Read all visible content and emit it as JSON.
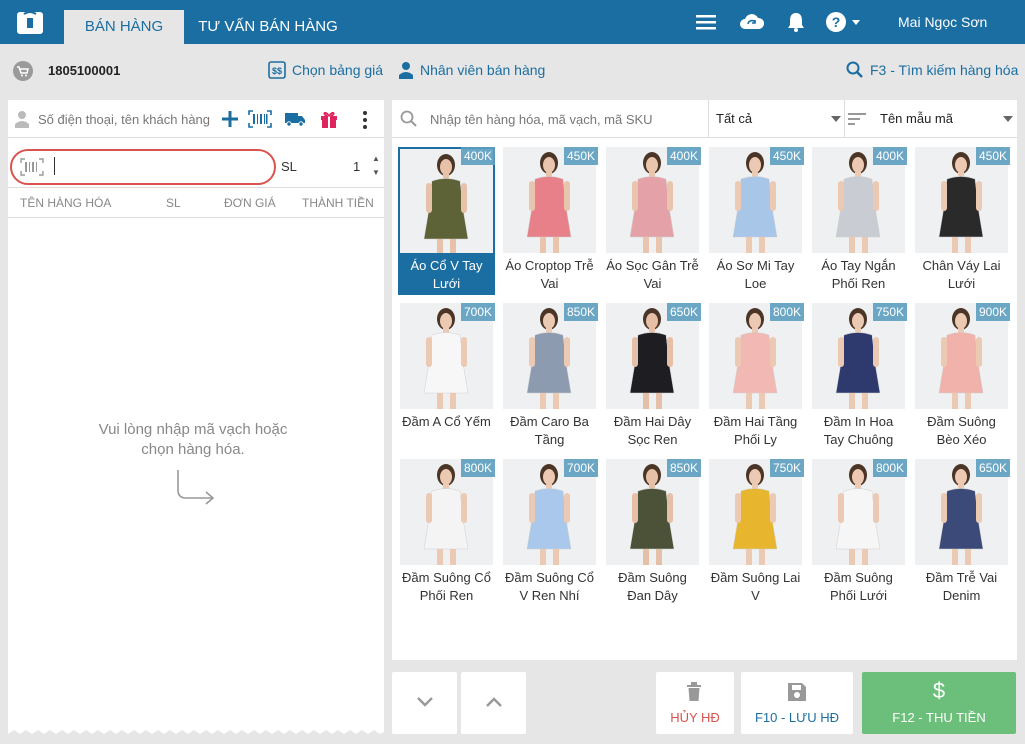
{
  "header": {
    "tabs": [
      "BÁN HÀNG",
      "TƯ VẤN BÁN HÀNG"
    ],
    "user": "Mai Ngọc Sơn",
    "icons": [
      "menu-icon",
      "cloud-sync-icon",
      "bell-icon",
      "help-icon"
    ]
  },
  "subbar": {
    "invoice_id": "1805100001",
    "price_list": "Chọn bảng giá",
    "sales_staff": "Nhân viên bán hàng",
    "search_hint": "F3 - Tìm kiếm hàng hóa"
  },
  "cart": {
    "customer_placeholder": "Số điện thoại, tên khách hàng",
    "qty_label": "SL",
    "qty_value": "1",
    "columns": [
      "TÊN HÀNG HÓA",
      "SL",
      "ĐƠN GIÁ",
      "THÀNH TIỀN"
    ],
    "empty_line1": "Vui lòng nhập mã vạch hoặc",
    "empty_line2": "chọn hàng hóa."
  },
  "catalog": {
    "search_placeholder": "Nhập tên hàng hóa, mã vạch, mã SKU",
    "filter_value": "Tất cả",
    "sort_value": "Tên mẫu mã",
    "products": [
      {
        "name1": "Áo Cổ V Tay",
        "name2": "Lưới",
        "price": "400K",
        "color": "#5e6237",
        "skin": "#e8c2a8",
        "selected": true
      },
      {
        "name1": "Áo Croptop Trễ",
        "name2": "Vai",
        "price": "450K",
        "color": "#e8808a",
        "skin": "#e9c5ae",
        "selected": false
      },
      {
        "name1": "Áo Sọc Gân Trễ",
        "name2": "Vai",
        "price": "400K",
        "color": "#e4a2a8",
        "skin": "#e9c5ae",
        "selected": false
      },
      {
        "name1": "Áo Sơ Mi Tay",
        "name2": "Loe",
        "price": "450K",
        "color": "#a8c6e8",
        "skin": "#ebc9b2",
        "selected": false
      },
      {
        "name1": "Áo Tay Ngắn",
        "name2": "Phối Ren",
        "price": "400K",
        "color": "#c9ccd2",
        "skin": "#ebc9b2",
        "selected": false
      },
      {
        "name1": "Chân Váy Lai",
        "name2": "Lưới",
        "price": "450K",
        "color": "#2a2a2a",
        "skin": "#ebc9b2",
        "selected": false
      },
      {
        "name1": "Đầm A Cổ Yếm",
        "name2": "",
        "price": "700K",
        "color": "#f7f7f7",
        "skin": "#ebc9b2",
        "selected": false
      },
      {
        "name1": "Đầm Caro Ba",
        "name2": "Tầng",
        "price": "850K",
        "color": "#8d9bb0",
        "skin": "#ebc9b2",
        "selected": false
      },
      {
        "name1": "Đầm Hai Dây",
        "name2": "Sọc Ren",
        "price": "650K",
        "color": "#1e1e22",
        "skin": "#e6c0a6",
        "selected": false
      },
      {
        "name1": "Đầm Hai Tầng",
        "name2": "Phối Ly",
        "price": "800K",
        "color": "#f2b9b4",
        "skin": "#ebc9b2",
        "selected": false
      },
      {
        "name1": "Đầm In Hoa",
        "name2": "Tay Chuông",
        "price": "750K",
        "color": "#2e3a6e",
        "skin": "#ebc9b2",
        "selected": false
      },
      {
        "name1": "Đầm Suông",
        "name2": "Bèo Xéo",
        "price": "900K",
        "color": "#f0b2aa",
        "skin": "#ebc9b2",
        "selected": false
      },
      {
        "name1": "Đầm Suông Cổ",
        "name2": "Phối Ren",
        "price": "800K",
        "color": "#f4f4f4",
        "skin": "#ebc9b2",
        "selected": false
      },
      {
        "name1": "Đầm Suông Cổ",
        "name2": "V Ren Nhí",
        "price": "700K",
        "color": "#a9c8ec",
        "skin": "#ebc9b2",
        "selected": false
      },
      {
        "name1": "Đầm Suông",
        "name2": "Đan Dây",
        "price": "850K",
        "color": "#4b5237",
        "skin": "#e6c0a6",
        "selected": false
      },
      {
        "name1": "Đầm Suông Lai",
        "name2": "V",
        "price": "750K",
        "color": "#e8b62e",
        "skin": "#ebc9b2",
        "selected": false
      },
      {
        "name1": "Đầm Suông",
        "name2": "Phối Lưới",
        "price": "800K",
        "color": "#f6f6f6",
        "skin": "#ebc9b2",
        "selected": false
      },
      {
        "name1": "Đầm Trễ Vai",
        "name2": "Denim",
        "price": "650K",
        "color": "#3b4a78",
        "skin": "#ebc9b2",
        "selected": false
      }
    ]
  },
  "actions": {
    "cancel": "HỦY HĐ",
    "save": "F10 - LƯU HĐ",
    "pay": "F12 - THU TIỀN"
  },
  "colors": {
    "brand": "#1b6ea1",
    "danger": "#d9534f",
    "success": "#6bbf7a",
    "price_tag": "#5c9ec0"
  }
}
